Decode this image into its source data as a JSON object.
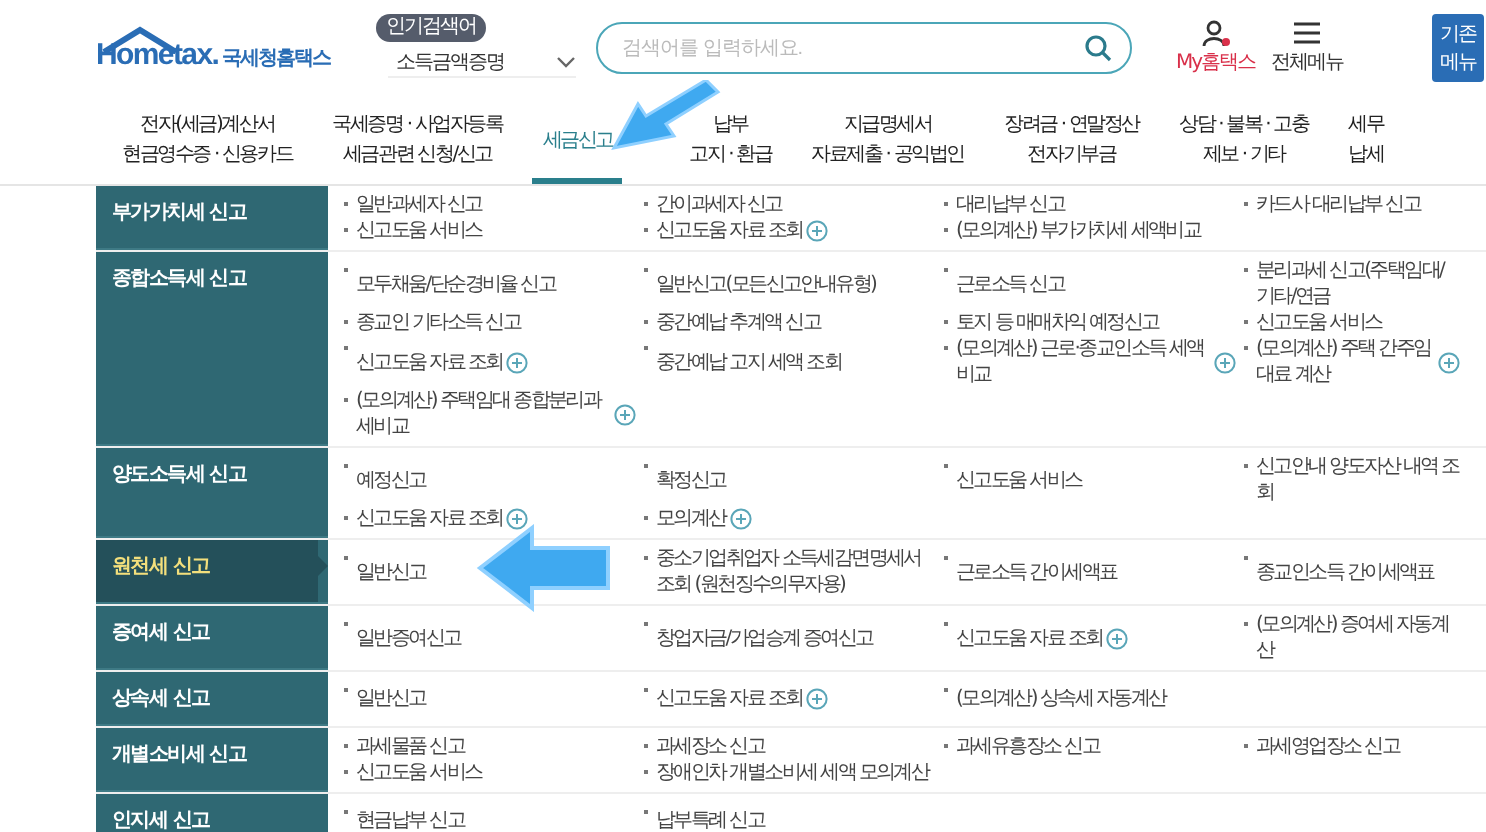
{
  "header": {
    "logo": "Hometax.",
    "site_name": "국세청홈택스",
    "popular_badge": "인기검색어",
    "popular_term": "소득금액증명",
    "search": {
      "placeholder": "검색어를 입력하세요."
    },
    "my_link": "My홈택스",
    "all_menu": "전체메뉴",
    "old_menu_button": [
      "기존",
      "메뉴"
    ]
  },
  "nav": [
    {
      "lines": [
        "전자(세금)계산서",
        "현금영수증 · 신용카드"
      ],
      "selected": false
    },
    {
      "lines": [
        "국세증명 · 사업자등록",
        "세금관련 신청/신고"
      ],
      "selected": false
    },
    {
      "lines": [
        "세금신고"
      ],
      "selected": true
    },
    {
      "lines": [
        "납부",
        "고지 · 환급"
      ],
      "selected": false
    },
    {
      "lines": [
        "지급명세서",
        "자료제출 · 공익법인"
      ],
      "selected": false
    },
    {
      "lines": [
        "장려금 · 연말정산",
        "전자기부금"
      ],
      "selected": false
    },
    {
      "lines": [
        "상담 · 불복 · 고충",
        "제보 · 기타"
      ],
      "selected": false
    },
    {
      "lines": [
        "세무",
        "납세"
      ],
      "selected": false
    }
  ],
  "categories": [
    {
      "name": "부가가치세 신고",
      "selected": false,
      "items": [
        {
          "text": "일반과세자 신고",
          "plus": false
        },
        {
          "text": "간이과세자 신고",
          "plus": false
        },
        {
          "text": "대리납부 신고",
          "plus": false
        },
        {
          "text": "카드사 대리납부 신고",
          "plus": false
        },
        {
          "text": "신고도움 서비스",
          "plus": false
        },
        {
          "text": "신고도움 자료 조회",
          "plus": true
        },
        {
          "text": "(모의계산) 부가가치세 세액비교",
          "plus": false
        }
      ]
    },
    {
      "name": "종합소득세 신고",
      "selected": false,
      "items": [
        {
          "text": "모두채움/단순경비율 신고",
          "plus": false
        },
        {
          "text": "일반신고(모든신고안내유형)",
          "plus": false
        },
        {
          "text": "근로소득 신고",
          "plus": false
        },
        {
          "text": "분리과세 신고(주택임대/기타/연금",
          "plus": false
        },
        {
          "text": "종교인 기타소득 신고",
          "plus": false
        },
        {
          "text": "중간예납 추계액 신고",
          "plus": false
        },
        {
          "text": "토지 등 매매차익 예정신고",
          "plus": false
        },
        {
          "text": "신고도움 서비스",
          "plus": false
        },
        {
          "text": "신고도움 자료 조회",
          "plus": true
        },
        {
          "text": "중간예납 고지 세액 조회",
          "plus": false
        },
        {
          "text": "(모의계산) 근로·종교인소득 세액비교",
          "plus": true
        },
        {
          "text": "(모의계산) 주택 간주임대료 계산",
          "plus": true
        },
        {
          "text": "(모의계산) 주택임대 종합분리과세비교",
          "plus": true
        }
      ]
    },
    {
      "name": "양도소득세 신고",
      "selected": false,
      "items": [
        {
          "text": "예정신고",
          "plus": false
        },
        {
          "text": "확정신고",
          "plus": false
        },
        {
          "text": "신고도움 서비스",
          "plus": false
        },
        {
          "text": "신고안내 양도자산 내역 조회",
          "plus": false
        },
        {
          "text": "신고도움 자료 조회",
          "plus": true
        },
        {
          "text": "모의계산",
          "plus": true
        }
      ]
    },
    {
      "name": "원천세 신고",
      "selected": true,
      "items": [
        {
          "text": "일반신고",
          "plus": false
        },
        {
          "text": "중소기업취업자 소득세감면명세서 조회 (원천징수의무자용)",
          "plus": false
        },
        {
          "text": "근로소득 간이세액표",
          "plus": false
        },
        {
          "text": "종교인소득 간이세액표",
          "plus": false
        }
      ]
    },
    {
      "name": "증여세 신고",
      "selected": false,
      "items": [
        {
          "text": "일반증여신고",
          "plus": false
        },
        {
          "text": "창업자금/가업승계 증여신고",
          "plus": false
        },
        {
          "text": "신고도움 자료 조회",
          "plus": true
        },
        {
          "text": "(모의계산) 증여세 자동계산",
          "plus": false
        }
      ]
    },
    {
      "name": "상속세 신고",
      "selected": false,
      "items": [
        {
          "text": "일반신고",
          "plus": false
        },
        {
          "text": "신고도움 자료 조회",
          "plus": true
        },
        {
          "text": "(모의계산) 상속세 자동계산",
          "plus": false
        }
      ]
    },
    {
      "name": "개별소비세 신고",
      "selected": false,
      "items": [
        {
          "text": "과세물품 신고",
          "plus": false
        },
        {
          "text": "과세장소 신고",
          "plus": false
        },
        {
          "text": "과세유흥장소 신고",
          "plus": false
        },
        {
          "text": "과세영업장소 신고",
          "plus": false
        },
        {
          "text": "신고도움 서비스",
          "plus": false
        },
        {
          "text": "장애인차 개별소비세 세액 모의계산",
          "plus": false
        }
      ]
    },
    {
      "name": "인지세 신고",
      "selected": false,
      "items": [
        {
          "text": "현금납부 신고",
          "plus": false
        },
        {
          "text": "납부특례 신고",
          "plus": false
        }
      ]
    }
  ]
}
